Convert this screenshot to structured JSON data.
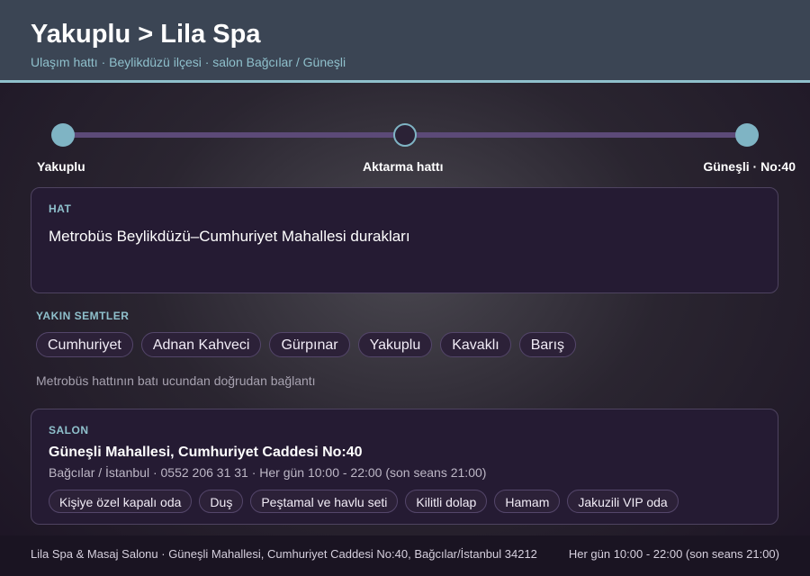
{
  "header": {
    "title": "Yakuplu > Lila Spa",
    "subtitle": "Ulaşım hattı · Beylikdüzü ilçesi · salon Bağcılar / Güneşli"
  },
  "route": {
    "stops": [
      {
        "label": "Yakuplu",
        "state": "filled"
      },
      {
        "label": "Aktarma hattı",
        "state": "hollow"
      },
      {
        "label": "Güneşli · No:40",
        "state": "filled"
      }
    ]
  },
  "line_card": {
    "label": "HAT",
    "text": "Metrobüs Beylikdüzü–Cumhuriyet Mahallesi durakları"
  },
  "nearby": {
    "label": "YAKIN SEMTLER",
    "chips": [
      "Cumhuriyet",
      "Adnan Kahveci",
      "Gürpınar",
      "Yakuplu",
      "Kavaklı",
      "Barış"
    ],
    "note": "Metrobüs hattının batı ucundan doğrudan bağlantı"
  },
  "salon": {
    "label": "SALON",
    "address": "Güneşli Mahallesi, Cumhuriyet Caddesi No:40",
    "meta": "Bağcılar / İstanbul · 0552 206 31 31 · Her gün 10:00 - 22:00 (son seans 21:00)",
    "amenities": [
      "Kişiye özel kapalı oda",
      "Duş",
      "Peştamal ve havlu seti",
      "Kilitli dolap",
      "Hamam",
      "Jakuzili VIP oda"
    ]
  },
  "footer": {
    "left": "Lila Spa & Masaj Salonu · Güneşli Mahallesi, Cumhuriyet Caddesi No:40, Bağcılar/İstanbul 34212",
    "right": "Her gün 10:00 - 22:00 (son seans 21:00)"
  },
  "colors": {
    "accent": "#8fc0cc",
    "header_bg": "#3b4554",
    "card_bg": "#251b33",
    "route_line": "#5c4a78"
  }
}
